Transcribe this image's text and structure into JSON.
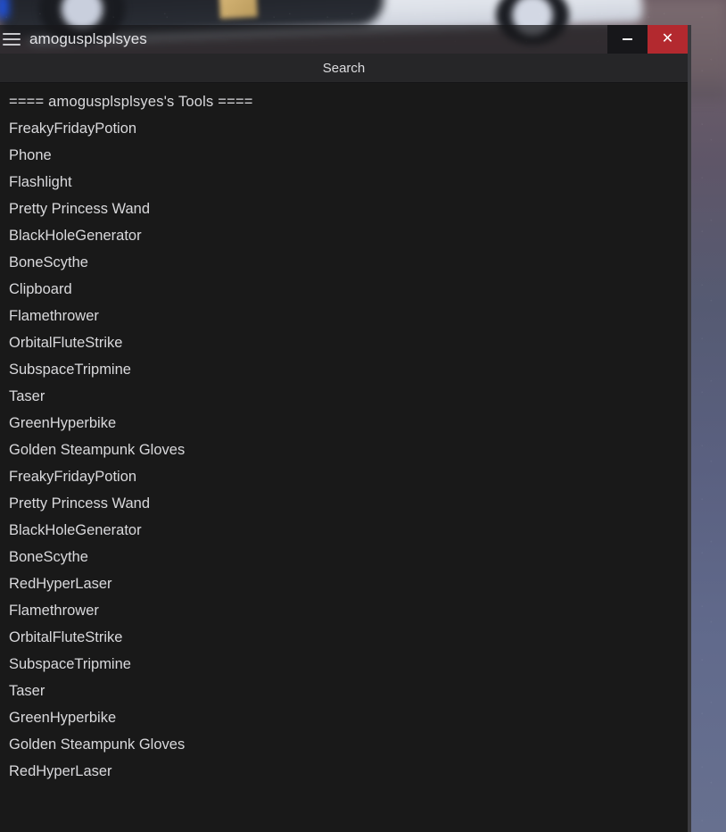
{
  "window": {
    "title": "amogusplsplsyes",
    "menu_icon": "hamburger-icon",
    "minimize_label": "-",
    "close_label": "✕",
    "accent_close_color": "#b3292f",
    "background_color": "#191919",
    "titlebar_color": "#18181a",
    "text_color": "#d9d9dc"
  },
  "search": {
    "label": "Search",
    "placeholder": "Search"
  },
  "tool_list": {
    "header": "==== amogusplsplsyes's Tools ====",
    "items": [
      "FreakyFridayPotion",
      "Phone",
      "Flashlight",
      "Pretty Princess Wand",
      "BlackHoleGenerator",
      "BoneScythe",
      "Clipboard",
      "Flamethrower",
      "OrbitalFluteStrike",
      "SubspaceTripmine",
      "Taser",
      "GreenHyperbike",
      "Golden Steampunk Gloves",
      "FreakyFridayPotion",
      "Pretty Princess Wand",
      "BlackHoleGenerator",
      "BoneScythe",
      "RedHyperLaser",
      "Flamethrower",
      "OrbitalFluteStrike",
      "SubspaceTripmine",
      "Taser",
      "GreenHyperbike",
      "Golden Steampunk Gloves",
      "RedHyperLaser"
    ]
  }
}
